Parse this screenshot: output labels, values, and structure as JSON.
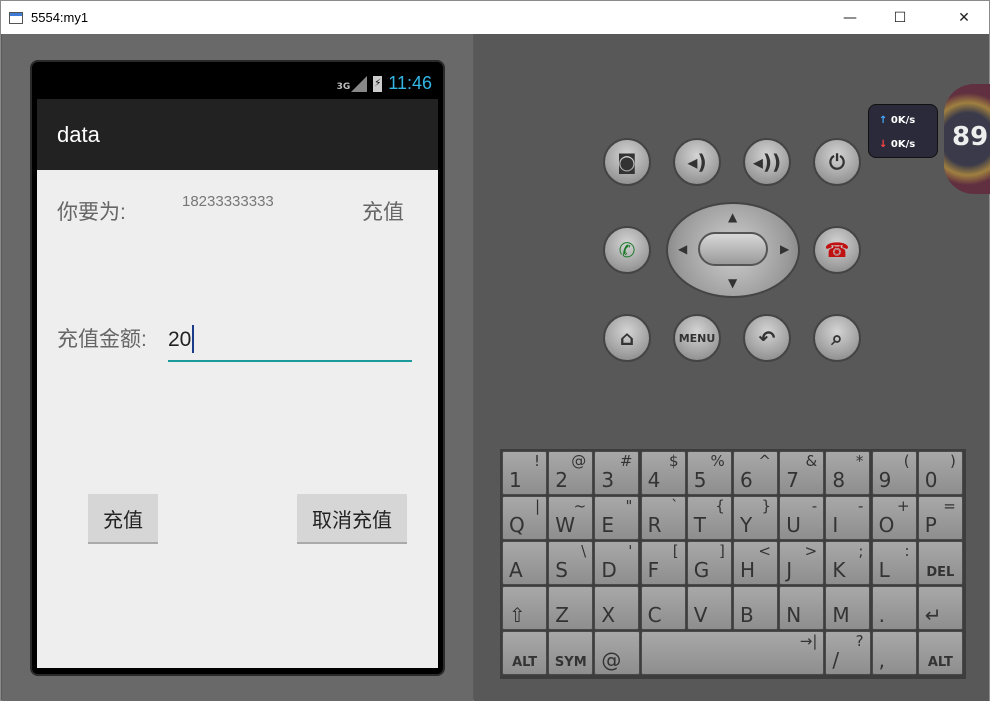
{
  "window": {
    "title": "5554:my1",
    "minimize": "—",
    "maximize": "☐",
    "close": "✕"
  },
  "status_bar": {
    "network": "3G",
    "time": "11:46"
  },
  "app": {
    "title": "data",
    "label_for": "你要为:",
    "phone_number": "18233333333",
    "label_recharge": "充值",
    "label_amount": "充值金额:",
    "amount_value": "20",
    "recharge_button": "充值",
    "cancel_button": "取消充值"
  },
  "controls": {
    "camera": "camera-icon",
    "vol_down": "volume-down-icon",
    "vol_up": "volume-up-icon",
    "power": "power-icon",
    "call": "call-icon",
    "endcall": "end-call-icon",
    "home": "home-icon",
    "menu": "MENU",
    "back": "back-icon",
    "search": "search-icon"
  },
  "net_monitor": {
    "up": "0",
    "up_unit": "K/s",
    "down": "0",
    "down_unit": "K/s",
    "badge": "89"
  },
  "keyboard": {
    "rows": [
      [
        [
          "1",
          "!"
        ],
        [
          "2",
          "@"
        ],
        [
          "3",
          "#"
        ],
        [
          "4",
          "$"
        ],
        [
          "5",
          "%"
        ],
        [
          "6",
          "^"
        ],
        [
          "7",
          "&"
        ],
        [
          "8",
          "*"
        ],
        [
          "9",
          "("
        ],
        [
          "0",
          ")"
        ]
      ],
      [
        [
          "Q",
          "|"
        ],
        [
          "W",
          "~"
        ],
        [
          "E",
          "\""
        ],
        [
          "R",
          "`"
        ],
        [
          "T",
          "{"
        ],
        [
          "Y",
          "}"
        ],
        [
          "U",
          "-"
        ],
        [
          "I",
          "-"
        ],
        [
          "O",
          "+"
        ],
        [
          "P",
          "="
        ]
      ],
      [
        [
          "A",
          ""
        ],
        [
          "S",
          "\\"
        ],
        [
          "D",
          "'"
        ],
        [
          "F",
          "["
        ],
        [
          "G",
          "]"
        ],
        [
          "H",
          "<"
        ],
        [
          "J",
          ">"
        ],
        [
          "K",
          ";"
        ],
        [
          "L",
          ":"
        ],
        [
          "DEL",
          ""
        ]
      ],
      [
        [
          "⇧",
          ""
        ],
        [
          "Z",
          ""
        ],
        [
          "X",
          ""
        ],
        [
          "C",
          ""
        ],
        [
          "V",
          ""
        ],
        [
          "B",
          ""
        ],
        [
          "N",
          ""
        ],
        [
          "M",
          ""
        ],
        [
          ".",
          ""
        ],
        [
          "↵",
          ""
        ]
      ]
    ],
    "bottom": {
      "alt_left": "ALT",
      "sym": "SYM",
      "at": "@",
      "space_tab": "→|",
      "slash": "/",
      "question": "?",
      "comma": ",",
      "alt_right": "ALT"
    }
  }
}
